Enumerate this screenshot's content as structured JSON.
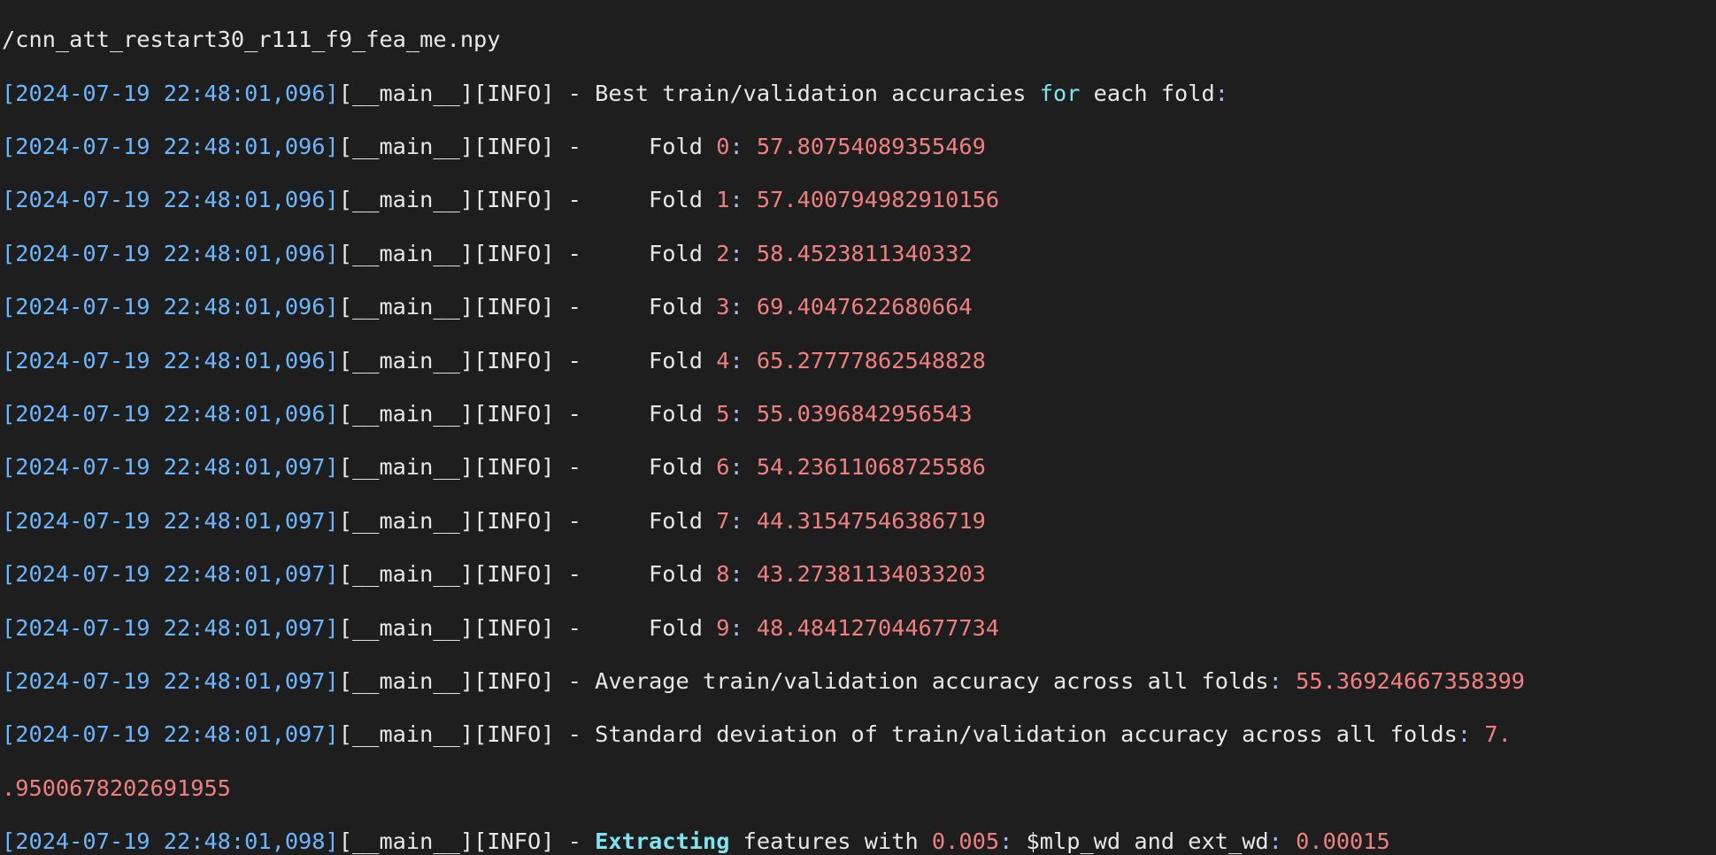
{
  "terminal": {
    "file_line": "/cnn_att_restart30_r111_f9_fea_me.npy",
    "logger": "[__main__][INFO] - ",
    "best_header": {
      "ts": "[2024-07-19 22:48:01,096]",
      "text_a": "Best train/validation accuracies ",
      "kw": "for",
      "text_b": " each fold",
      "colon": ":"
    },
    "folds": [
      {
        "ts": "[2024-07-19 22:48:01,096]",
        "label": "    Fold ",
        "idx": "0",
        "value": "57.80754089355469"
      },
      {
        "ts": "[2024-07-19 22:48:01,096]",
        "label": "    Fold ",
        "idx": "1",
        "value": "57.400794982910156"
      },
      {
        "ts": "[2024-07-19 22:48:01,096]",
        "label": "    Fold ",
        "idx": "2",
        "value": "58.4523811340332"
      },
      {
        "ts": "[2024-07-19 22:48:01,096]",
        "label": "    Fold ",
        "idx": "3",
        "value": "69.4047622680664"
      },
      {
        "ts": "[2024-07-19 22:48:01,096]",
        "label": "    Fold ",
        "idx": "4",
        "value": "65.27777862548828"
      },
      {
        "ts": "[2024-07-19 22:48:01,096]",
        "label": "    Fold ",
        "idx": "5",
        "value": "55.0396842956543"
      },
      {
        "ts": "[2024-07-19 22:48:01,097]",
        "label": "    Fold ",
        "idx": "6",
        "value": "54.23611068725586"
      },
      {
        "ts": "[2024-07-19 22:48:01,097]",
        "label": "    Fold ",
        "idx": "7",
        "value": "44.31547546386719"
      },
      {
        "ts": "[2024-07-19 22:48:01,097]",
        "label": "    Fold ",
        "idx": "8",
        "value": "43.27381134033203"
      },
      {
        "ts": "[2024-07-19 22:48:01,097]",
        "label": "    Fold ",
        "idx": "9",
        "value": "48.484127044677734"
      }
    ],
    "average": {
      "ts": "[2024-07-19 22:48:01,097]",
      "text": "Average train/validation accuracy across all folds",
      "colon": ": ",
      "value": "55.36924667358399"
    },
    "stddev": {
      "ts": "[2024-07-19 22:48:01,097]",
      "text": "Standard deviation of train/validation accuracy across all folds",
      "colon": ": ",
      "value_a": "7.",
      "value_b": ".9500678202691955"
    },
    "extract": {
      "ts": "[2024-07-19 22:48:01,098]",
      "kw": "Extracting",
      "text_a": " features with ",
      "value_a": "0.005",
      "colon_a": ":",
      "text_b": " $mlp_wd and ext_wd",
      "colon_b": ": ",
      "value_b": "0.00015"
    }
  },
  "colors": {
    "background": "#1e1e1e",
    "foreground": "#e8e8e8",
    "timestamp": "#6cb6ff",
    "number": "#f08080",
    "keyword": "#7fe3f0"
  }
}
